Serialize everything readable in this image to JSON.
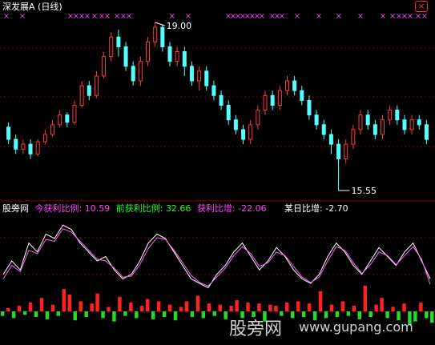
{
  "colors": {
    "background": "#000000",
    "grid": "#8b0000",
    "up_candle": "#ff3b3b",
    "down_candle": "#54ffff",
    "marker": "#ff44ff",
    "header_text": "#ffffff",
    "hist_up": "#ff2020",
    "hist_down": "#22dd22",
    "line_a": "#ffffff",
    "line_b": "#ff66ff",
    "close_icon": "#ff3030"
  },
  "top_panel": {
    "title": "深发展A",
    "period": "(日线)",
    "marker_glyph": "×",
    "high_label": "19.00",
    "low_label": "15.55"
  },
  "bottom_panel": {
    "source": "股旁网",
    "ind1_label": "今获利比例:",
    "ind1_value": "10.59",
    "ind2_label": "前获利比例:",
    "ind2_value": "32.66",
    "ind3_label": "获利比增:",
    "ind3_value": "-22.06",
    "ind4_label": "某日比增:",
    "ind4_value": "-2.70"
  },
  "watermark": {
    "cn": "股旁网",
    "url": "www.gupang.com"
  },
  "chart_data": {
    "type": "candlestick",
    "price_high": 19.0,
    "price_low": 15.55,
    "candles": [
      [
        16.85,
        16.6,
        16.95,
        16.5
      ],
      [
        16.6,
        16.4,
        16.7,
        16.3
      ],
      [
        16.4,
        16.5,
        16.6,
        16.3
      ],
      [
        16.5,
        16.3,
        16.6,
        16.2
      ],
      [
        16.3,
        16.55,
        16.6,
        16.25
      ],
      [
        16.55,
        16.7,
        16.8,
        16.5
      ],
      [
        16.7,
        16.9,
        17.0,
        16.65
      ],
      [
        16.9,
        17.1,
        17.2,
        16.85
      ],
      [
        17.1,
        16.95,
        17.15,
        16.85
      ],
      [
        16.95,
        17.3,
        17.4,
        16.9
      ],
      [
        17.3,
        17.7,
        17.8,
        17.25
      ],
      [
        17.7,
        17.5,
        17.8,
        17.4
      ],
      [
        17.5,
        17.9,
        18.0,
        17.45
      ],
      [
        17.9,
        18.3,
        18.4,
        17.85
      ],
      [
        18.3,
        18.7,
        18.8,
        18.2
      ],
      [
        18.7,
        18.5,
        18.85,
        18.3
      ],
      [
        18.5,
        18.1,
        18.6,
        18.0
      ],
      [
        18.1,
        17.8,
        18.2,
        17.7
      ],
      [
        17.8,
        18.2,
        18.3,
        17.7
      ],
      [
        18.2,
        18.6,
        18.7,
        18.1
      ],
      [
        18.6,
        18.9,
        19.0,
        18.5
      ],
      [
        18.9,
        18.5,
        18.95,
        18.4
      ],
      [
        18.5,
        18.2,
        18.6,
        18.1
      ],
      [
        18.2,
        18.4,
        18.5,
        18.1
      ],
      [
        18.4,
        18.1,
        18.5,
        17.9
      ],
      [
        18.1,
        17.8,
        18.2,
        17.7
      ],
      [
        17.8,
        18.0,
        18.1,
        17.6
      ],
      [
        18.0,
        17.7,
        18.1,
        17.6
      ],
      [
        17.7,
        17.5,
        17.8,
        17.4
      ],
      [
        17.5,
        17.3,
        17.6,
        17.2
      ],
      [
        17.3,
        17.0,
        17.4,
        16.9
      ],
      [
        17.0,
        16.8,
        17.1,
        16.7
      ],
      [
        16.8,
        16.6,
        16.9,
        16.5
      ],
      [
        16.6,
        16.9,
        17.0,
        16.5
      ],
      [
        16.9,
        17.2,
        17.3,
        16.8
      ],
      [
        17.2,
        17.5,
        17.6,
        17.1
      ],
      [
        17.5,
        17.3,
        17.6,
        17.2
      ],
      [
        17.3,
        17.6,
        17.7,
        17.2
      ],
      [
        17.6,
        17.8,
        17.9,
        17.5
      ],
      [
        17.8,
        17.6,
        17.9,
        17.5
      ],
      [
        17.6,
        17.4,
        17.7,
        17.3
      ],
      [
        17.4,
        17.1,
        17.5,
        17.0
      ],
      [
        17.1,
        16.9,
        17.2,
        16.8
      ],
      [
        16.9,
        16.7,
        17.0,
        16.6
      ],
      [
        16.7,
        16.5,
        16.8,
        16.3
      ],
      [
        16.5,
        16.2,
        16.6,
        15.55
      ],
      [
        16.2,
        16.5,
        16.6,
        16.1
      ],
      [
        16.5,
        16.8,
        16.9,
        16.4
      ],
      [
        16.8,
        17.1,
        17.2,
        16.7
      ],
      [
        17.1,
        16.9,
        17.2,
        16.8
      ],
      [
        16.9,
        16.7,
        17.0,
        16.6
      ],
      [
        16.7,
        17.0,
        17.1,
        16.6
      ],
      [
        17.0,
        17.2,
        17.3,
        16.9
      ],
      [
        17.2,
        17.0,
        17.3,
        16.9
      ],
      [
        17.0,
        16.8,
        17.1,
        16.7
      ],
      [
        16.8,
        17.0,
        17.1,
        16.7
      ],
      [
        17.0,
        16.9,
        17.1,
        16.8
      ],
      [
        16.9,
        16.6,
        17.0,
        16.5
      ]
    ],
    "hist_values": [
      -0.4,
      0.3,
      -0.6,
      0.5,
      -0.3,
      0.8,
      -0.5,
      1.2,
      -0.7,
      0.6,
      -0.4,
      2.0,
      1.5,
      -0.8,
      0.9,
      -0.5,
      0.7,
      1.6,
      -0.6,
      0.4,
      -0.9,
      1.3,
      -0.4,
      0.8,
      -0.6,
      0.5,
      1.1,
      -0.7,
      0.9,
      -0.5,
      0.6,
      -0.8,
      0.4,
      0.9,
      -0.5,
      1.4,
      -0.6,
      0.7,
      -0.4,
      0.6,
      -0.7,
      0.5,
      1.0,
      -0.6,
      0.8,
      -0.5,
      0.7,
      -0.9,
      0.6,
      0.5,
      -0.4,
      0.8,
      -0.6,
      0.9,
      -0.5,
      0.7,
      -0.8,
      1.8,
      -0.6,
      0.6,
      -0.5,
      0.9,
      -0.4,
      0.5,
      -0.7,
      2.3,
      -0.5,
      0.6,
      1.2,
      -0.6,
      0.4,
      -0.8,
      0.7,
      -1.2,
      -0.9,
      0.8,
      -0.6,
      -1.0
    ],
    "line_a": [
      0.35,
      0.5,
      0.4,
      0.7,
      0.6,
      0.8,
      0.75,
      0.9,
      0.85,
      0.7,
      0.6,
      0.5,
      0.55,
      0.4,
      0.3,
      0.35,
      0.5,
      0.7,
      0.8,
      0.75,
      0.6,
      0.45,
      0.3,
      0.25,
      0.2,
      0.35,
      0.45,
      0.6,
      0.7,
      0.55,
      0.4,
      0.5,
      0.65,
      0.55,
      0.4,
      0.3,
      0.25,
      0.35,
      0.55,
      0.7,
      0.6,
      0.45,
      0.35,
      0.5,
      0.65,
      0.55,
      0.45,
      0.6,
      0.7,
      0.5,
      0.3
    ],
    "line_b": [
      0.3,
      0.45,
      0.38,
      0.62,
      0.58,
      0.74,
      0.72,
      0.86,
      0.82,
      0.72,
      0.62,
      0.52,
      0.5,
      0.42,
      0.32,
      0.33,
      0.46,
      0.64,
      0.76,
      0.74,
      0.62,
      0.48,
      0.34,
      0.26,
      0.22,
      0.32,
      0.42,
      0.56,
      0.66,
      0.58,
      0.44,
      0.48,
      0.6,
      0.56,
      0.44,
      0.32,
      0.26,
      0.32,
      0.5,
      0.66,
      0.62,
      0.48,
      0.36,
      0.46,
      0.6,
      0.56,
      0.46,
      0.56,
      0.66,
      0.52,
      0.24
    ]
  }
}
